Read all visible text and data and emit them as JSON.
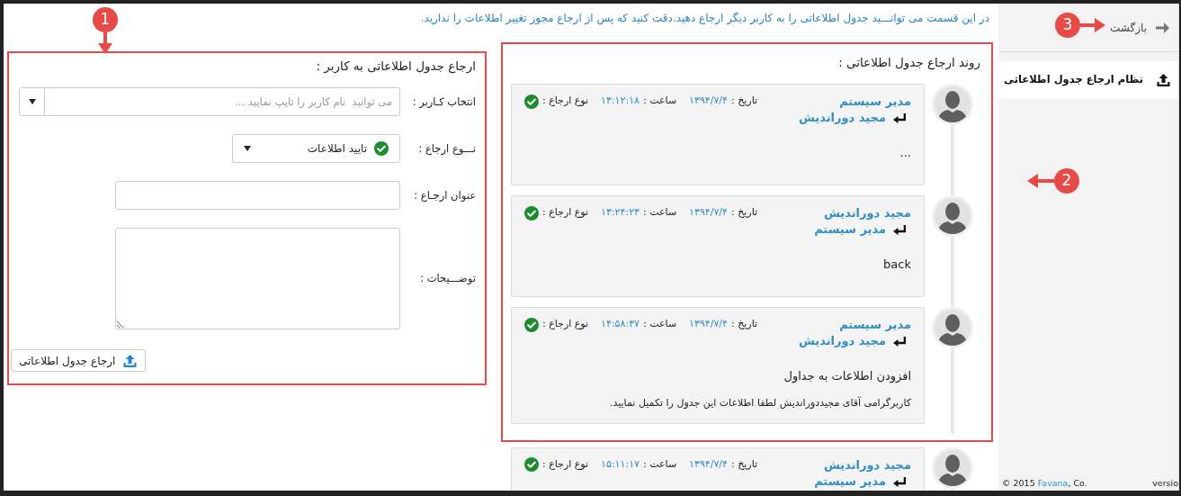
{
  "info_text": "در این قسمت می توانـــید جدول اطلاعاتی را به کاربر دیگر ارجاع دهید.دقت کنید که پس از ارجاع مجوز تغییر اطلاعات را ندارید.",
  "form": {
    "callout": "1",
    "title": "ارجاع جدول اطلاعاتی به کاربر :",
    "fields": [
      {
        "kind": "combo",
        "label": "انتخاب کـاربر :",
        "placeholder": "می توانید  نام کاربر را تایپ نمایید ..."
      },
      {
        "kind": "select",
        "label": "نـــوع ارجاع :",
        "value": "تایید اطلاعات"
      },
      {
        "kind": "text",
        "label": "عنوان ارجـاع :"
      },
      {
        "kind": "textarea",
        "label": "توضـــیحات :"
      }
    ],
    "submit": "ارجاع جدول اطلاعاتی"
  },
  "timeline": {
    "callout": "2",
    "title": "روند ارجاع جدول اطلاعاتی :",
    "entries": [
      {
        "sender": "مدیر سیستم",
        "recipient": "مجید دوراندیش",
        "date_label": "تاریخ :",
        "date": "۱۳۹۴/۷/۴",
        "time_label": "ساعت :",
        "time": "۱۳:۱۲:۱۸",
        "type_label": "نوع ارجاع :",
        "messages": [
          "..."
        ]
      },
      {
        "sender": "مجید دوراندیش",
        "recipient": "مدیر سیستم",
        "date_label": "تاریخ :",
        "date": "۱۳۹۴/۷/۴",
        "time_label": "ساعت :",
        "time": "۱۳:۲۴:۲۳",
        "type_label": "نوع ارجاع :",
        "messages": [
          "back"
        ]
      },
      {
        "sender": "مدیر سیستم",
        "recipient": "مجید دوراندیش",
        "date_label": "تاریخ :",
        "date": "۱۳۹۴/۷/۴",
        "time_label": "ساعت :",
        "time": "۱۴:۵۸:۳۷",
        "type_label": "نوع ارجاع :",
        "messages": [
          "افزودن اطلاعات به جداول",
          "کاربرگرامی آقای مجیددوراندیش لطفا اطلاعات این جدول را تکمیل نمایید."
        ]
      }
    ],
    "entries_below": [
      {
        "sender": "مجید دوراندیش",
        "recipient": "مدیر سیستم",
        "date_label": "تاریخ :",
        "date": "۱۳۹۴/۷/۴",
        "time_label": "ساعت :",
        "time": "۱۵:۱۱:۱۷",
        "type_label": "نوع ارجاع :"
      }
    ]
  },
  "sidebar": {
    "back": "بازگشت",
    "back_callout": "3",
    "items": [
      {
        "label": "نظام ارجاع جدول اطلاعاتی",
        "selected": true
      }
    ],
    "footer": {
      "prefix": "© 2015 ",
      "link": "Favana",
      "suffix": ", Co.",
      "version": "versio"
    }
  }
}
